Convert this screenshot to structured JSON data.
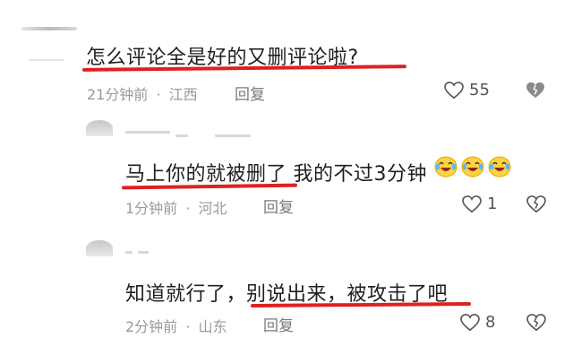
{
  "comments": [
    {
      "text": "怎么评论全是好的又删评论啦?",
      "time": "21分钟前",
      "sep": "·",
      "location": "江西",
      "reply": "回复",
      "likes": "55"
    },
    {
      "text": "马上你的就被删了 我的不过3分钟",
      "time": "1分钟前",
      "sep": "·",
      "location": "河北",
      "reply": "回复",
      "likes": "1",
      "emoji_count": 3
    },
    {
      "text": "知道就行了，别说出来，被攻击了吧",
      "time": "2分钟前",
      "sep": "·",
      "location": "山东",
      "reply": "回复",
      "likes": "8"
    }
  ],
  "colors": {
    "underline": "#e02020",
    "meta": "#9a9a9a",
    "text": "#1f1f1f"
  },
  "icons": [
    "heart-outline-icon",
    "broken-heart-icon",
    "crying-laughing-emoji-icon"
  ]
}
